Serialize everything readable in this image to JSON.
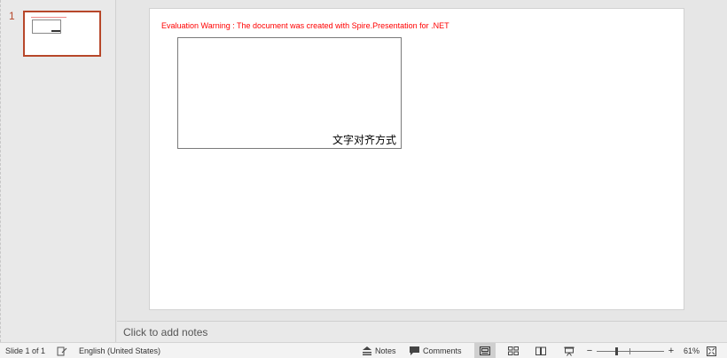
{
  "thumbnails": {
    "slide_number": "1"
  },
  "slide": {
    "warning_text": "Evaluation Warning : The document was created with  Spire.Presentation for .NET",
    "textbox_text": "文字对齐方式"
  },
  "notes": {
    "placeholder": "Click to add notes"
  },
  "status_bar": {
    "slide_count": "Slide 1 of 1",
    "language": "English (United States)",
    "notes_label": "Notes",
    "comments_label": "Comments",
    "zoom_out": "−",
    "zoom_in": "+",
    "zoom_level": "61%",
    "zoom_fraction": 0.61
  },
  "colors": {
    "accent": "#b7472a",
    "warning": "#ff0000"
  }
}
